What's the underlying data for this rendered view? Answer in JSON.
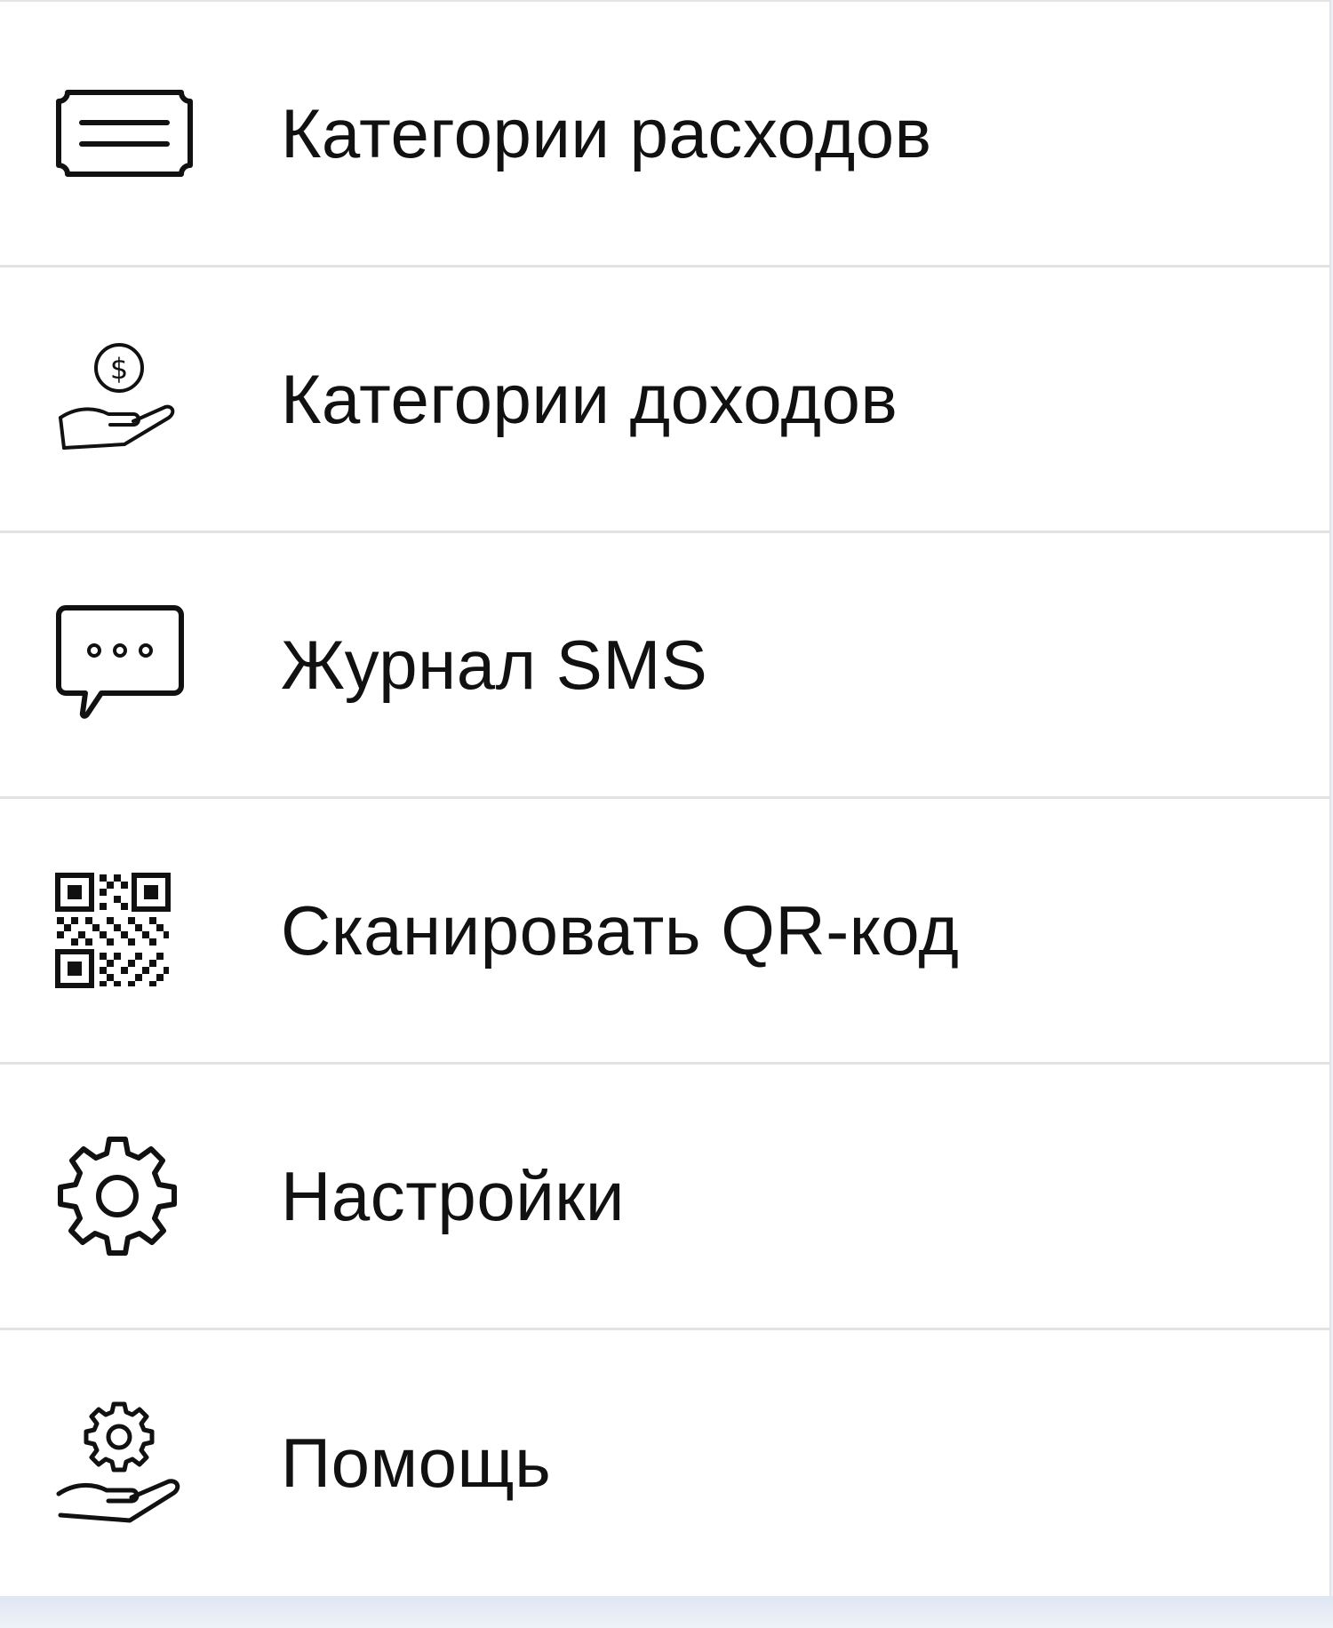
{
  "menu": {
    "items": [
      {
        "label": "Категории расходов",
        "icon": "ticket-list-icon"
      },
      {
        "label": "Категории доходов",
        "icon": "coin-hand-icon"
      },
      {
        "label": "Журнал SMS",
        "icon": "chat-bubble-icon"
      },
      {
        "label": "Сканировать QR-код",
        "icon": "qr-code-icon"
      },
      {
        "label": "Настройки",
        "icon": "gear-icon"
      },
      {
        "label": "Помощь",
        "icon": "gear-hand-icon"
      }
    ]
  },
  "colors": {
    "text": "#111111",
    "divider": "#e3e3e3",
    "background": "#ffffff",
    "page_background": "#eef2f8"
  }
}
